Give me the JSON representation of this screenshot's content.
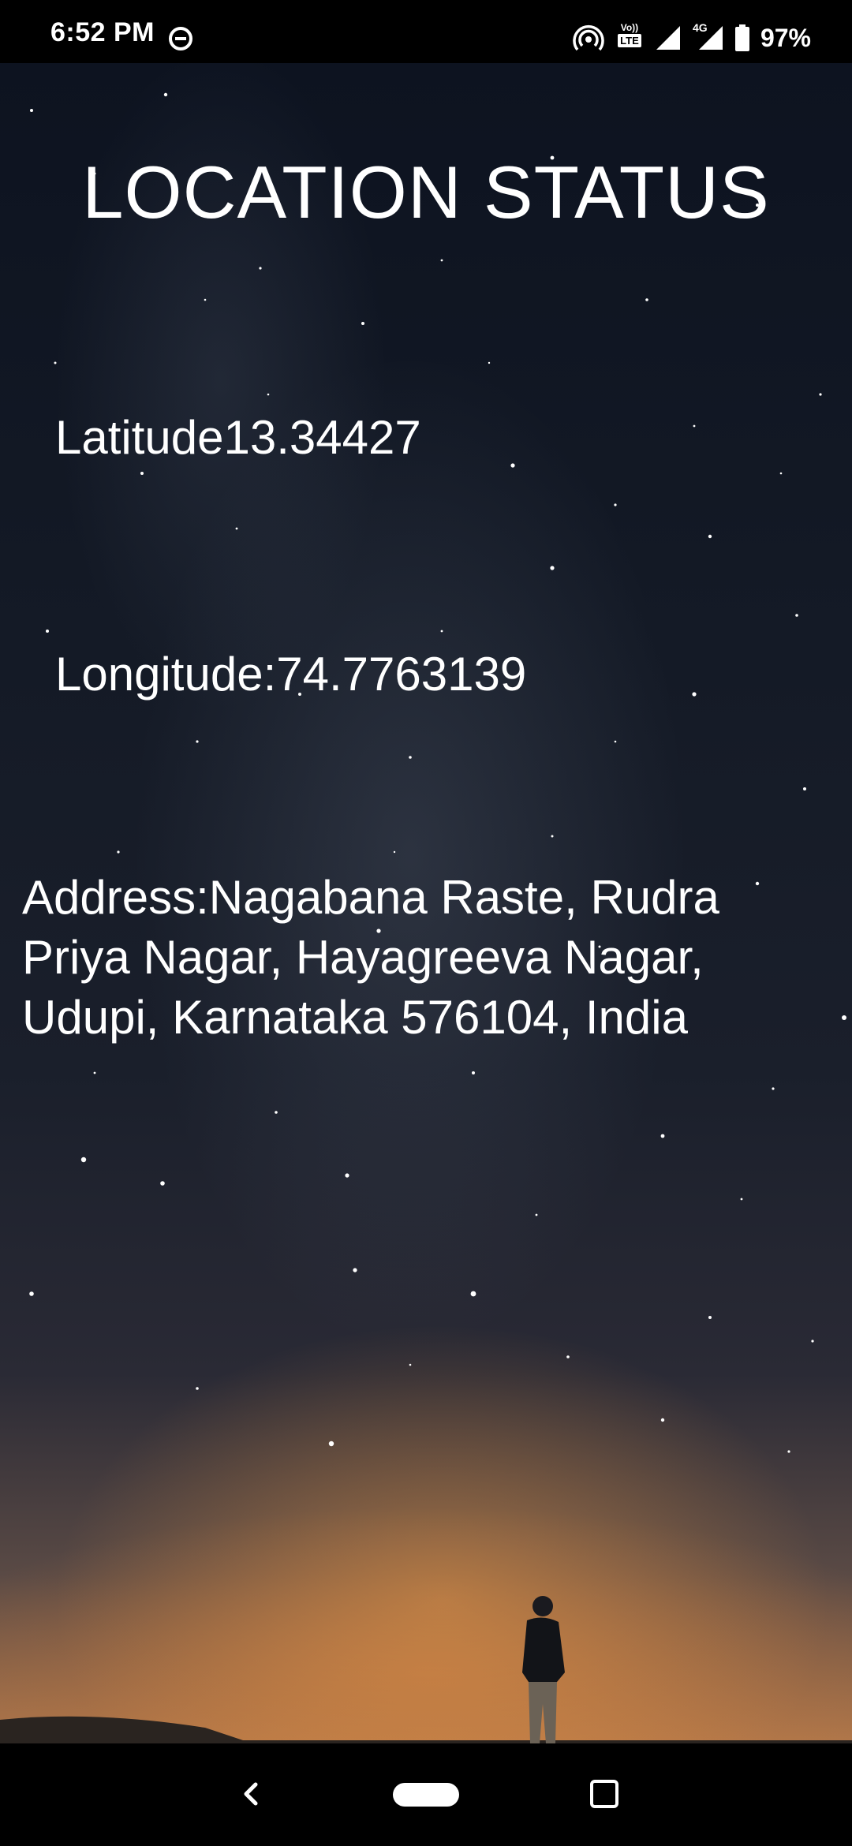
{
  "status_bar": {
    "time": "6:52 PM",
    "icons": [
      "do-not-disturb-icon",
      "hotspot-icon",
      "volte-icon",
      "signal-icon",
      "network-4g-icon",
      "battery-icon"
    ],
    "volte_label_top": "Vo))",
    "volte_label_bottom": "LTE",
    "network_label": "4G",
    "battery_percent": "97%"
  },
  "main": {
    "title": "LOCATION STATUS",
    "latitude_text": "Latitude13.34427",
    "longitude_text": "Longitude:74.7763139",
    "address_text": "Address:Nagabana Raste, Rudra Priya Nagar, Hayagreeva Nagar, Udupi, Karnataka 576104, India"
  },
  "background": {
    "description_icon": "night-sky-background",
    "colors": {
      "sky_top": "#0d1320",
      "horizon": "#b0774a",
      "text": "#ffffff"
    }
  },
  "nav_bar": {
    "buttons": [
      "back-icon",
      "home-pill",
      "recents-icon"
    ]
  }
}
